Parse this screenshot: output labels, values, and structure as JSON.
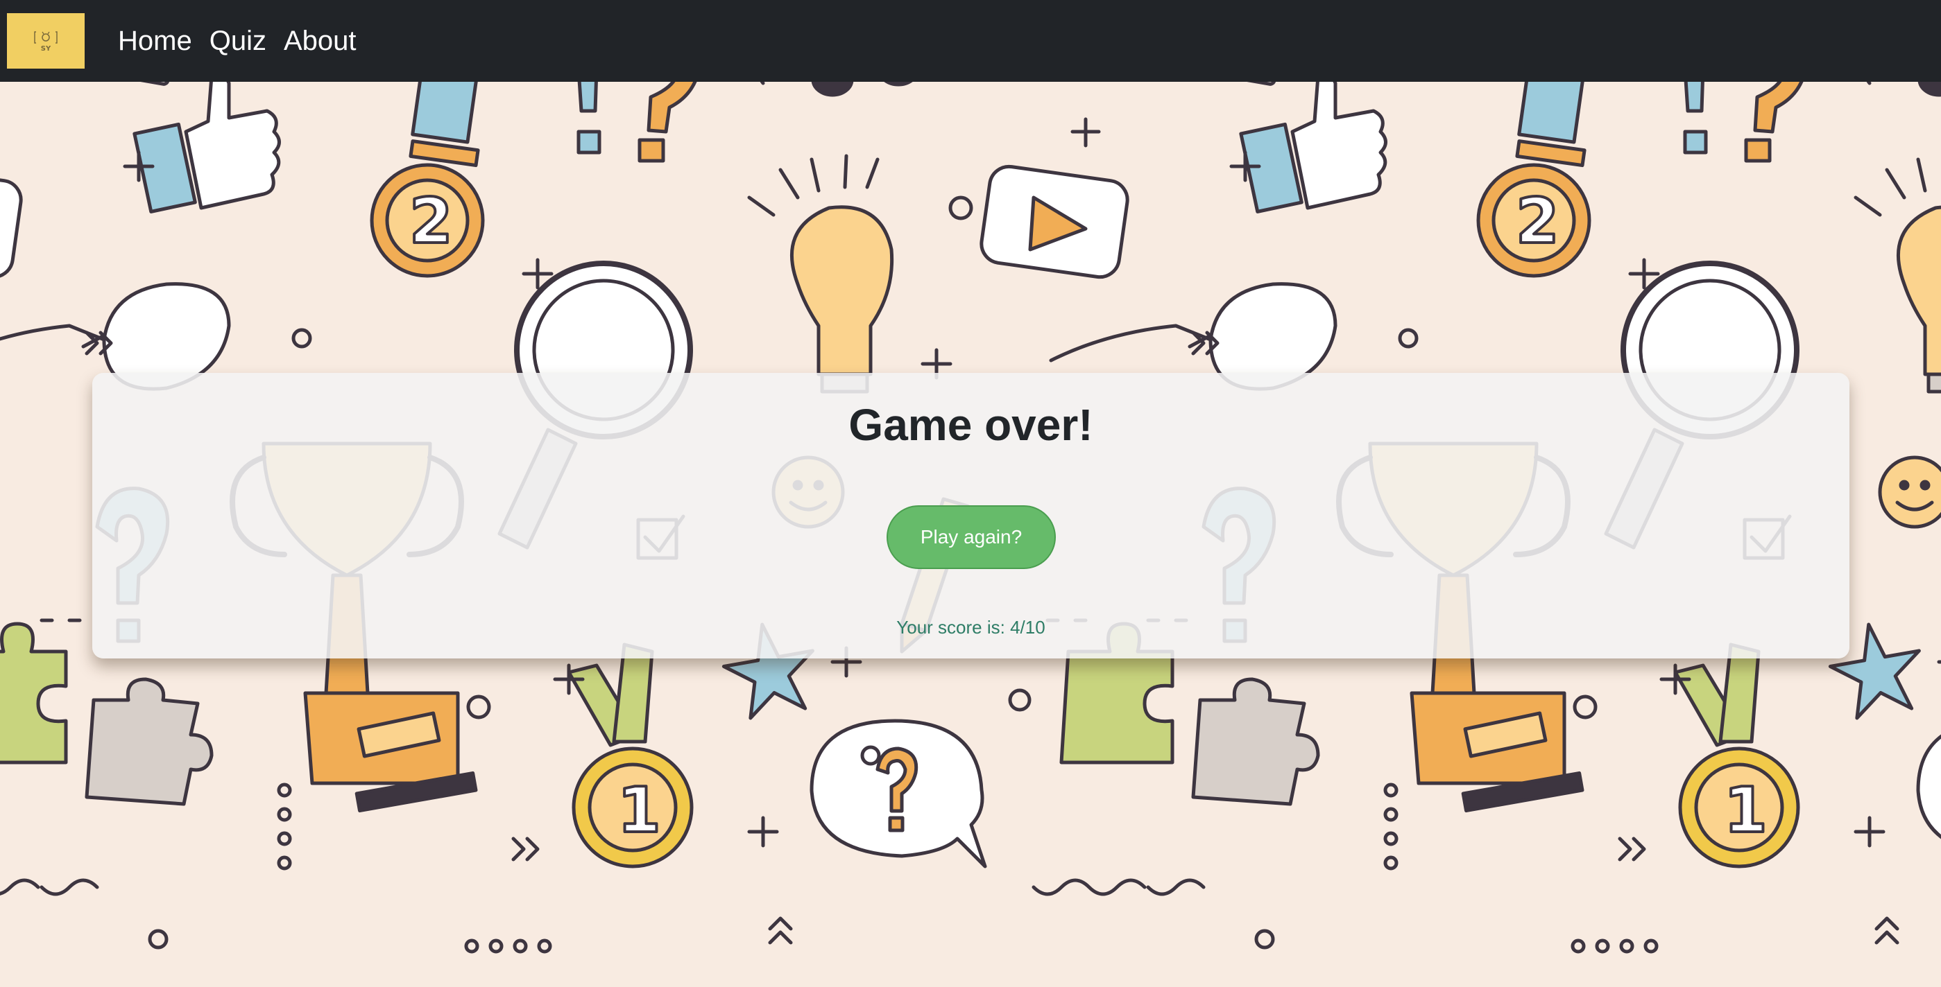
{
  "navbar": {
    "logo_icon": "quiz-logo-icon",
    "logo_text": "SY",
    "links": [
      {
        "label": "Home"
      },
      {
        "label": "Quiz"
      },
      {
        "label": "About"
      }
    ],
    "background_color": "#212428",
    "logo_color": "#f1cf62"
  },
  "result": {
    "title": "Game over!",
    "play_again_label": "Play again?",
    "score_text": "Your score is: 4/10"
  },
  "background": {
    "pattern_color": "#f8ebe1",
    "icons": [
      "thumbs-up-icon",
      "medal-2-icon",
      "exclamation-question-icon",
      "music-note-icon",
      "lightbulb-icon",
      "play-button-icon",
      "globe-icon",
      "glasses-icon",
      "magnifier-icon",
      "trophy-icon",
      "question-mark-icon",
      "smiley-icon",
      "checkbox-icon",
      "pencil-icon",
      "star-icon",
      "puzzle-piece-icon",
      "medal-1-icon",
      "speech-bubble-question-icon"
    ]
  },
  "colors": {
    "button": "#66bb6a",
    "score": "#2e7d66",
    "title": "#212529"
  }
}
